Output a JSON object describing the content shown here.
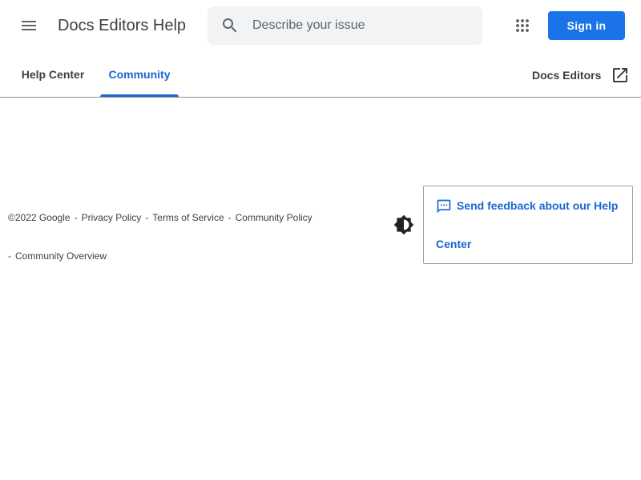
{
  "header": {
    "title": "Docs Editors Help",
    "search_placeholder": "Describe your issue",
    "signin_label": "Sign in",
    "icons": {
      "menu": "menu-icon",
      "search": "search-icon",
      "apps": "apps-grid-icon"
    }
  },
  "tabs": {
    "help_center": "Help Center",
    "community": "Community",
    "active": "Community",
    "external_link": "Docs Editors"
  },
  "footer": {
    "copyright": "©2022 Google",
    "links": [
      "Privacy Policy",
      "Terms of Service",
      "Community Policy",
      "Community Overview"
    ],
    "separator": "-",
    "feedback_label": "Send feedback about our Help Center"
  },
  "colors": {
    "accent": "#1a73e8",
    "link": "#1967d2",
    "text": "#3c4043",
    "search_bg": "#f1f3f4"
  }
}
